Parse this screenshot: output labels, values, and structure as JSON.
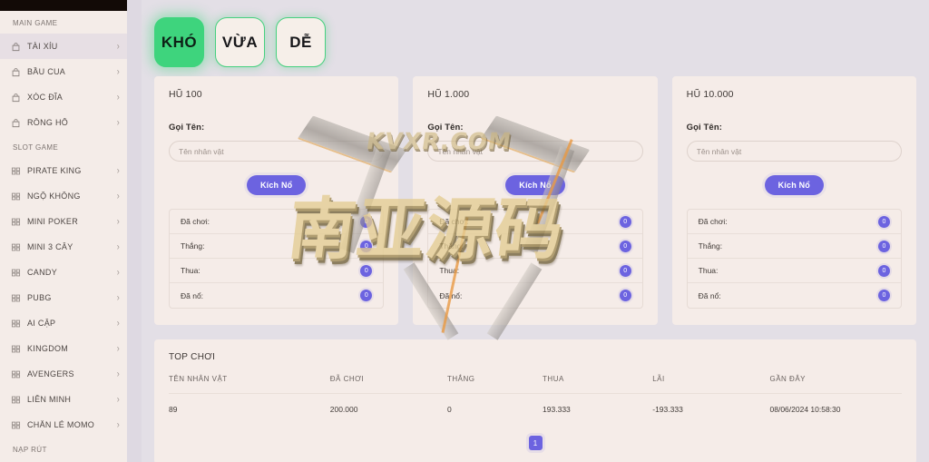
{
  "sidebar": {
    "sections": [
      {
        "label": "MAIN GAME",
        "items": [
          {
            "label": "TÀI XỈU",
            "icon": "bag-icon",
            "active": true
          },
          {
            "label": "BẦU CUA",
            "icon": "bag-icon",
            "active": false
          },
          {
            "label": "XÓC ĐĨA",
            "icon": "bag-icon",
            "active": false
          },
          {
            "label": "RỒNG HỔ",
            "icon": "bag-icon",
            "active": false
          }
        ]
      },
      {
        "label": "SLOT GAME",
        "items": [
          {
            "label": "PIRATE KING",
            "icon": "grid-icon",
            "active": false
          },
          {
            "label": "NGỘ KHÔNG",
            "icon": "grid-icon",
            "active": false
          },
          {
            "label": "MINI POKER",
            "icon": "grid-icon",
            "active": false
          },
          {
            "label": "MINI 3 CÂY",
            "icon": "grid-icon",
            "active": false
          },
          {
            "label": "CANDY",
            "icon": "grid-icon",
            "active": false
          },
          {
            "label": "PUBG",
            "icon": "grid-icon",
            "active": false
          },
          {
            "label": "AI CẬP",
            "icon": "grid-icon",
            "active": false
          },
          {
            "label": "KINGDOM",
            "icon": "grid-icon",
            "active": false
          },
          {
            "label": "AVENGERS",
            "icon": "grid-icon",
            "active": false
          },
          {
            "label": "LIÊN MINH",
            "icon": "grid-icon",
            "active": false
          },
          {
            "label": "CHẴN LẺ MOMO",
            "icon": "grid-icon",
            "active": false
          }
        ]
      },
      {
        "label": "NẠP RÚT",
        "items": []
      }
    ],
    "chevron": "›"
  },
  "difficulty": {
    "options": [
      {
        "label": "KHÓ",
        "selected": true
      },
      {
        "label": "VỪA",
        "selected": false
      },
      {
        "label": "DỄ",
        "selected": false
      }
    ]
  },
  "cards": [
    {
      "title": "HŨ 100",
      "field_label": "Gọi Tên:",
      "input_value": "",
      "input_placeholder": "Tên nhân vật",
      "button_label": "Kích Nổ",
      "stats": [
        {
          "label": "Đã chơi:",
          "value": "0"
        },
        {
          "label": "Thắng:",
          "value": "0"
        },
        {
          "label": "Thua:",
          "value": "0"
        },
        {
          "label": "Đã nổ:",
          "value": "0"
        }
      ]
    },
    {
      "title": "HŨ 1.000",
      "field_label": "Gọi Tên:",
      "input_value": "",
      "input_placeholder": "Tên nhân vật",
      "button_label": "Kích Nổ",
      "stats": [
        {
          "label": "Đã chơi:",
          "value": "0"
        },
        {
          "label": "Thắng:",
          "value": "0"
        },
        {
          "label": "Thua:",
          "value": "0"
        },
        {
          "label": "Đã nổ:",
          "value": "0"
        }
      ]
    },
    {
      "title": "HŨ 10.000",
      "field_label": "Gọi Tên:",
      "input_value": "",
      "input_placeholder": "Tên nhân vật",
      "button_label": "Kích Nổ",
      "stats": [
        {
          "label": "Đã chơi:",
          "value": "0"
        },
        {
          "label": "Thắng:",
          "value": "0"
        },
        {
          "label": "Thua:",
          "value": "0"
        },
        {
          "label": "Đã nổ:",
          "value": "0"
        }
      ]
    }
  ],
  "top_players": {
    "title": "TOP CHƠI",
    "columns": [
      "TÊN NHÂN VẬT",
      "ĐÃ CHƠI",
      "THẮNG",
      "THUA",
      "LÃI",
      "GẦN ĐÂY"
    ],
    "rows": [
      [
        "89",
        "200.000",
        "0",
        "193.333",
        "-193.333",
        "08/06/2024 10:58:30"
      ]
    ],
    "pagination": {
      "pages": [
        "1"
      ],
      "current": "1"
    }
  },
  "watermark": {
    "domain": "KVXR.COM",
    "cjk": "南亚源码"
  },
  "colors": {
    "accent_purple": "#6c63e0",
    "accent_green": "#3ed47d",
    "panel_bg": "#f5ece8",
    "sidebar_bg": "#f4ece8",
    "watermark_gold": "#e4cd93"
  }
}
